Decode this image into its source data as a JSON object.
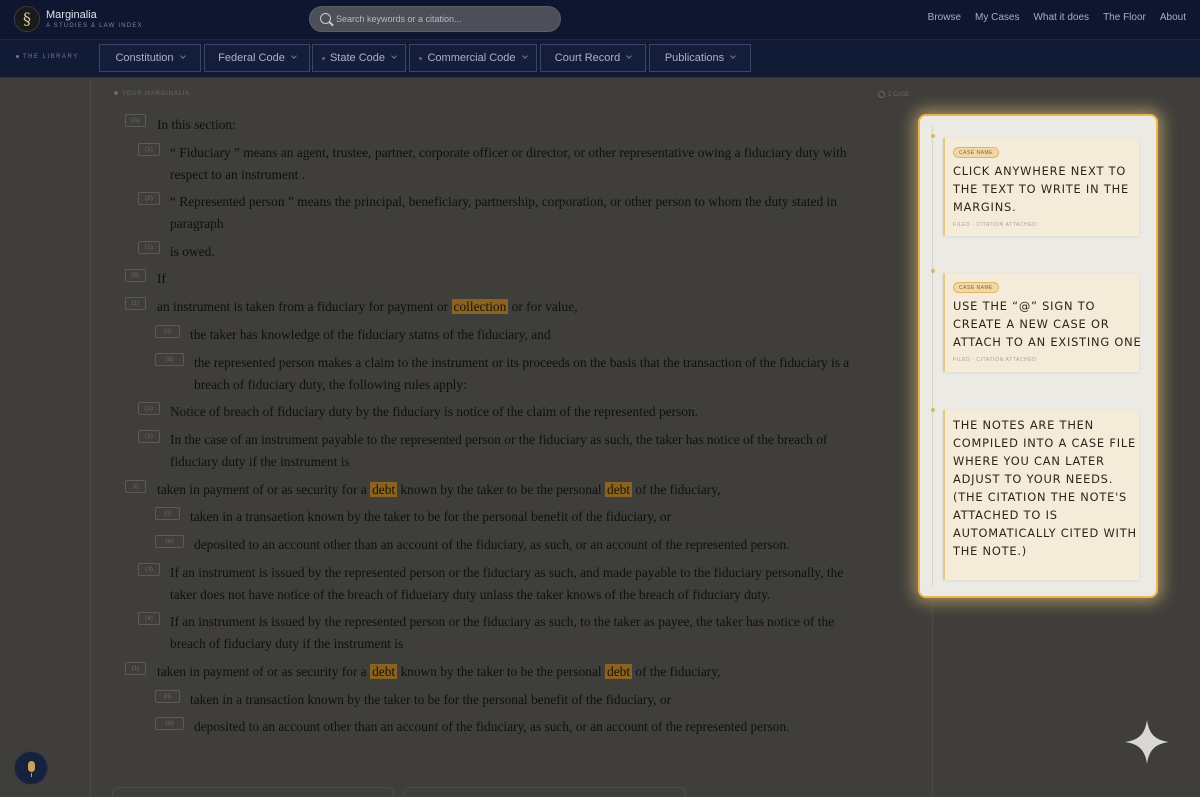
{
  "header": {
    "logo_glyph": "§",
    "brand_name": "Marginalia",
    "brand_tagline": "A STUDIES & LAW INDEX",
    "search_placeholder": "Search keywords or a citation...",
    "nav": [
      "Browse",
      "My Cases",
      "What it does",
      "The Floor",
      "About"
    ]
  },
  "categories": {
    "library_label": "THE LIBRARY",
    "items": [
      "Constitution",
      "Federal Code",
      "State Code",
      "Commercial Code",
      "Court Record",
      "Publications"
    ]
  },
  "doc": {
    "your_marginalia": "YOUR MARGINALIA",
    "case_count": "1 CASE",
    "lines": [
      {
        "tag": "(A)",
        "text": "In this section:"
      },
      {
        "tag": "(1)",
        "text": "“ Fiduciary ” means an agent, trustee, partner, corporate officer or director, or other representative owing a fiduciary duty with"
      },
      {
        "text": "respect to an instrument ."
      },
      {
        "tag": "(2)",
        "text": "“ Represented person ” means the principal, beneficiary, partnership, corporation, or other person to whom the duty stated in"
      },
      {
        "text": "paragraph"
      },
      {
        "tag": "(1)",
        "text": "is owed."
      },
      {
        "tag": "(B)",
        "text": "If"
      },
      {
        "tag": "(1)",
        "pre": "an instrument is taken from a fiduciary for payment or ",
        "hl": "collection",
        "post": " or for value,"
      },
      {
        "tag": "(ii)",
        "text": "the taker has knowledge of the fiduciary statns of the fiduciary, and"
      },
      {
        "tag": "(iii)",
        "text": "the represented person makes a claim to the instrument or its proceeds on the basis that the transaction of the fiduciary is a"
      },
      {
        "text": "breach of fiduciary duty, the following rules apply:"
      },
      {
        "tag": "(1)",
        "text": "Notice of breach of fiduciary duty by the fiduciary is notice of the claim of the represented person."
      },
      {
        "tag": "(2)",
        "text": "In the case of an instrument payable to the represented person or the fiduciary as such, the taker has notice of the breach of"
      },
      {
        "text": "fiduciary duty if the instrument is"
      },
      {
        "tag": "(i)",
        "pre": "taken in payment of or as security for a ",
        "hl": "debt",
        "mid": " known by the taker to be the personal ",
        "hl2": "debt",
        "post": " of the fiduciary,"
      },
      {
        "tag": "(ii)",
        "text": "taken in a transaetion known by the taker to be for the personal benefit of the fiduciary, or"
      },
      {
        "tag": "(iii)",
        "text": "deposited to an account other than an account of the fiduciary, as such, or an account of the represented person."
      },
      {
        "tag": "(3)",
        "text": "If an instrument is issued by the represented person or the fiduciary as such, and made payable to the fiduciary personally, the"
      },
      {
        "text": "taker does not have notice of the breach of fidueiary duty unlass the taker knows of the breach of fiduciary duty."
      },
      {
        "tag": "(4)",
        "text": "If an instrument is issued by the represented person or the fiduciary as such, to the taker as payee, the taker has notice of the"
      },
      {
        "text": "breach of fiduciary duty if the instrument is"
      },
      {
        "tag": "(1)",
        "pre": "taken in payment of or as security for a ",
        "hl": "debt",
        "mid": " known by the taker to be the personal ",
        "hl2": "debt",
        "post": " of the fiduciary,"
      },
      {
        "tag": "(ii)",
        "text": "taken in a transaction known by the taker to be for the personal benefit of the fiduciary, or"
      },
      {
        "tag": "(iii)",
        "text": "deposited to an account other than an account of the fiduciary, as such, or an account of the represented person."
      }
    ]
  },
  "notes": [
    {
      "pill": "CASE NAME",
      "lines": [
        "CLICK ANYWHERE NEXT TO",
        "THE TEXT TO WRITE IN THE",
        "MARGINS."
      ],
      "meta": "FILED · CITATION ATTACHED"
    },
    {
      "pill": "CASE NAME",
      "lines": [
        "USE THE “@” SIGN TO",
        "CREATE A NEW CASE OR",
        "ATTACH TO AN EXISTING ONE"
      ],
      "meta": "FILED · CITATION ATTACHED"
    },
    {
      "lines": [
        "THE NOTES ARE THEN",
        "COMPILED INTO A CASE FILE",
        "WHERE YOU CAN LATER",
        "ADJUST TO YOUR NEEDS.",
        "(THE CITATION THE NOTE'S",
        "ATTACHED TO IS",
        "AUTOMATICALLY CITED WITH",
        "THE NOTE.)"
      ]
    }
  ],
  "colors": {
    "accent": "#f0b54a",
    "highlight": "#8a6320",
    "nav_bg": "#0f1730"
  }
}
